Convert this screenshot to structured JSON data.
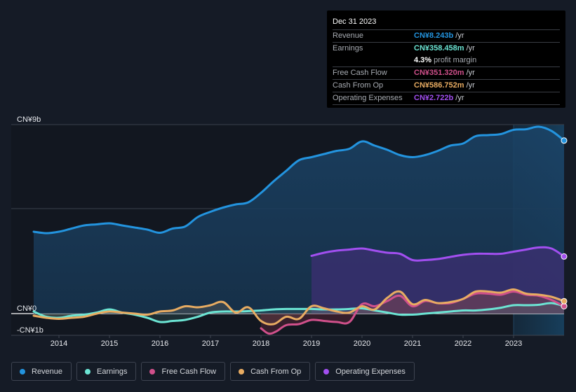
{
  "tooltip": {
    "date": "Dec 31 2023",
    "rows": [
      {
        "label": "Revenue",
        "value": "CN¥8.243b",
        "unit": "/yr",
        "color": "#2394df"
      },
      {
        "label": "Earnings",
        "value": "CN¥358.458m",
        "unit": "/yr",
        "color": "#6ce5d4"
      },
      {
        "label": "",
        "margin_value": "4.3%",
        "margin_text": "profit margin"
      },
      {
        "label": "Free Cash Flow",
        "value": "CN¥351.320m",
        "unit": "/yr",
        "color": "#d0508b"
      },
      {
        "label": "Cash From Op",
        "value": "CN¥586.752m",
        "unit": "/yr",
        "color": "#e8ac62"
      },
      {
        "label": "Operating Expenses",
        "value": "CN¥2.722b",
        "unit": "/yr",
        "color": "#a24ff0"
      }
    ]
  },
  "legend": [
    {
      "label": "Revenue",
      "color": "#2394df"
    },
    {
      "label": "Earnings",
      "color": "#6ce5d4"
    },
    {
      "label": "Free Cash Flow",
      "color": "#d0508b"
    },
    {
      "label": "Cash From Op",
      "color": "#e8ac62"
    },
    {
      "label": "Operating Expenses",
      "color": "#a24ff0"
    }
  ],
  "chart_data": {
    "type": "area",
    "title": "",
    "xlabel": "",
    "ylabel": "",
    "y_unit": "CN¥ billions",
    "ylim": [
      -1,
      9
    ],
    "xlim": [
      2013.5,
      2024.0
    ],
    "y_tick_labels": [
      {
        "value": 9,
        "label": "CN¥9b"
      },
      {
        "value": 0,
        "label": "CN¥0"
      },
      {
        "value": -1,
        "label": "-CN¥1b"
      }
    ],
    "x_tick_labels": [
      "2014",
      "2015",
      "2016",
      "2017",
      "2018",
      "2019",
      "2020",
      "2021",
      "2022",
      "2023"
    ],
    "x_ticks": [
      2014,
      2015,
      2016,
      2017,
      2018,
      2019,
      2020,
      2021,
      2022,
      2023
    ],
    "gridlines": [
      9,
      5,
      0
    ],
    "highlight_from": 2023.0,
    "legend_position": "bottom",
    "series": [
      {
        "name": "Revenue",
        "color": "#2394df",
        "x": [
          2013.5,
          2013.75,
          2014.0,
          2014.25,
          2014.5,
          2014.75,
          2015.0,
          2015.25,
          2015.5,
          2015.75,
          2016.0,
          2016.25,
          2016.5,
          2016.75,
          2017.0,
          2017.25,
          2017.5,
          2017.75,
          2018.0,
          2018.25,
          2018.5,
          2018.75,
          2019.0,
          2019.25,
          2019.5,
          2019.75,
          2020.0,
          2020.25,
          2020.5,
          2020.75,
          2021.0,
          2021.25,
          2021.5,
          2021.75,
          2022.0,
          2022.25,
          2022.5,
          2022.75,
          2023.0,
          2023.25,
          2023.5,
          2023.75,
          2024.0
        ],
        "values": [
          3.9,
          3.83,
          3.9,
          4.05,
          4.2,
          4.25,
          4.3,
          4.2,
          4.1,
          4.0,
          3.85,
          4.05,
          4.15,
          4.6,
          4.85,
          5.05,
          5.2,
          5.3,
          5.75,
          6.3,
          6.8,
          7.3,
          7.45,
          7.6,
          7.75,
          7.85,
          8.2,
          8.0,
          7.8,
          7.55,
          7.45,
          7.55,
          7.75,
          8.0,
          8.1,
          8.45,
          8.5,
          8.55,
          8.75,
          8.78,
          8.9,
          8.7,
          8.24
        ]
      },
      {
        "name": "Earnings",
        "color": "#6ce5d4",
        "x": [
          2013.5,
          2013.75,
          2014.0,
          2014.25,
          2014.5,
          2014.75,
          2015.0,
          2015.25,
          2015.5,
          2015.75,
          2016.0,
          2016.25,
          2016.5,
          2016.75,
          2017.0,
          2017.25,
          2017.5,
          2017.75,
          2018.0,
          2018.25,
          2018.5,
          2018.75,
          2019.0,
          2019.25,
          2019.5,
          2019.75,
          2020.0,
          2020.25,
          2020.5,
          2020.75,
          2021.0,
          2021.25,
          2021.5,
          2021.75,
          2022.0,
          2022.25,
          2022.5,
          2022.75,
          2023.0,
          2023.25,
          2023.5,
          2023.75,
          2024.0
        ],
        "values": [
          0.1,
          -0.15,
          -0.2,
          -0.1,
          -0.05,
          0.05,
          0.2,
          0.05,
          -0.05,
          -0.2,
          -0.4,
          -0.35,
          -0.3,
          -0.15,
          0.05,
          0.1,
          0.1,
          0.12,
          0.15,
          0.2,
          0.22,
          0.22,
          0.22,
          0.2,
          0.2,
          0.22,
          0.25,
          0.15,
          0.05,
          -0.05,
          -0.05,
          0.0,
          0.05,
          0.1,
          0.15,
          0.15,
          0.2,
          0.28,
          0.4,
          0.4,
          0.42,
          0.5,
          0.36
        ]
      },
      {
        "name": "Free Cash Flow",
        "color": "#d0508b",
        "x": [
          2018.0,
          2018.15,
          2018.3,
          2018.5,
          2018.75,
          2019.0,
          2019.25,
          2019.5,
          2019.75,
          2020.0,
          2020.25,
          2020.5,
          2020.75,
          2021.0,
          2021.25,
          2021.5,
          2021.75,
          2022.0,
          2022.25,
          2022.5,
          2022.75,
          2023.0,
          2023.25,
          2023.5,
          2023.75,
          2024.0
        ],
        "values": [
          -0.7,
          -0.95,
          -0.85,
          -0.55,
          -0.5,
          -0.3,
          -0.35,
          -0.4,
          -0.4,
          0.45,
          0.35,
          0.6,
          0.85,
          0.35,
          0.6,
          0.5,
          0.5,
          0.7,
          0.95,
          0.95,
          0.9,
          1.05,
          0.9,
          0.85,
          0.65,
          0.35
        ]
      },
      {
        "name": "Cash From Op",
        "color": "#e8ac62",
        "x": [
          2013.5,
          2013.75,
          2014.0,
          2014.25,
          2014.5,
          2014.75,
          2015.0,
          2015.25,
          2015.5,
          2015.75,
          2016.0,
          2016.25,
          2016.5,
          2016.75,
          2017.0,
          2017.25,
          2017.5,
          2017.75,
          2018.0,
          2018.25,
          2018.5,
          2018.75,
          2019.0,
          2019.25,
          2019.5,
          2019.75,
          2020.0,
          2020.25,
          2020.5,
          2020.75,
          2021.0,
          2021.25,
          2021.5,
          2021.75,
          2022.0,
          2022.25,
          2022.5,
          2022.75,
          2023.0,
          2023.25,
          2023.5,
          2023.75,
          2024.0
        ],
        "values": [
          -0.1,
          -0.2,
          -0.25,
          -0.2,
          -0.15,
          0.0,
          0.1,
          0.05,
          0.0,
          -0.05,
          0.1,
          0.15,
          0.35,
          0.3,
          0.4,
          0.55,
          0.05,
          0.3,
          -0.35,
          -0.5,
          -0.15,
          -0.25,
          0.35,
          0.25,
          0.1,
          0.05,
          0.35,
          0.2,
          0.75,
          1.05,
          0.45,
          0.65,
          0.5,
          0.55,
          0.7,
          1.05,
          1.05,
          1.0,
          1.15,
          0.95,
          0.9,
          0.8,
          0.59
        ]
      },
      {
        "name": "Operating Expenses",
        "color": "#a24ff0",
        "x": [
          2019.0,
          2019.25,
          2019.5,
          2019.75,
          2020.0,
          2020.25,
          2020.5,
          2020.75,
          2021.0,
          2021.25,
          2021.5,
          2021.75,
          2022.0,
          2022.25,
          2022.5,
          2022.75,
          2023.0,
          2023.25,
          2023.5,
          2023.75,
          2024.0
        ],
        "values": [
          2.75,
          2.9,
          3.0,
          3.05,
          3.1,
          3.0,
          2.9,
          2.85,
          2.55,
          2.55,
          2.6,
          2.7,
          2.8,
          2.85,
          2.85,
          2.85,
          2.95,
          3.05,
          3.15,
          3.1,
          2.72
        ]
      }
    ]
  }
}
